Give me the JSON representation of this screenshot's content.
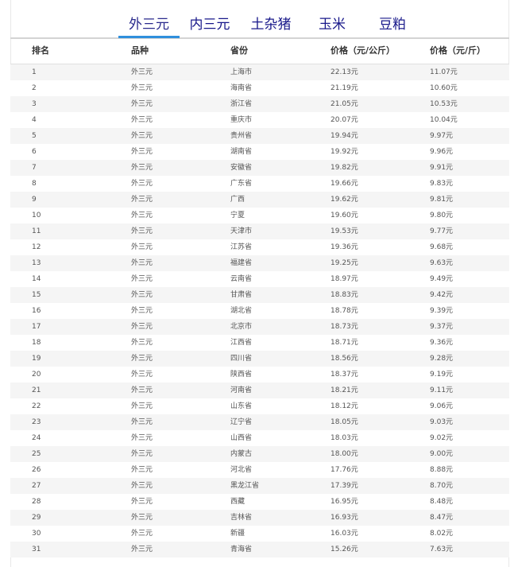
{
  "tabs": [
    {
      "label": "外三元",
      "active": true
    },
    {
      "label": "内三元",
      "active": false
    },
    {
      "label": "土杂猪",
      "active": false
    },
    {
      "label": "玉米",
      "active": false
    },
    {
      "label": "豆粕",
      "active": false
    }
  ],
  "table": {
    "headers": [
      "排名",
      "品种",
      "省份",
      "价格（元/公斤）",
      "价格（元/斤）"
    ],
    "rows": [
      [
        "1",
        "外三元",
        "上海市",
        "22.13元",
        "11.07元"
      ],
      [
        "2",
        "外三元",
        "海南省",
        "21.19元",
        "10.60元"
      ],
      [
        "3",
        "外三元",
        "浙江省",
        "21.05元",
        "10.53元"
      ],
      [
        "4",
        "外三元",
        "重庆市",
        "20.07元",
        "10.04元"
      ],
      [
        "5",
        "外三元",
        "贵州省",
        "19.94元",
        "9.97元"
      ],
      [
        "6",
        "外三元",
        "湖南省",
        "19.92元",
        "9.96元"
      ],
      [
        "7",
        "外三元",
        "安徽省",
        "19.82元",
        "9.91元"
      ],
      [
        "8",
        "外三元",
        "广东省",
        "19.66元",
        "9.83元"
      ],
      [
        "9",
        "外三元",
        "广西",
        "19.62元",
        "9.81元"
      ],
      [
        "10",
        "外三元",
        "宁夏",
        "19.60元",
        "9.80元"
      ],
      [
        "11",
        "外三元",
        "天津市",
        "19.53元",
        "9.77元"
      ],
      [
        "12",
        "外三元",
        "江苏省",
        "19.36元",
        "9.68元"
      ],
      [
        "13",
        "外三元",
        "福建省",
        "19.25元",
        "9.63元"
      ],
      [
        "14",
        "外三元",
        "云南省",
        "18.97元",
        "9.49元"
      ],
      [
        "15",
        "外三元",
        "甘肃省",
        "18.83元",
        "9.42元"
      ],
      [
        "16",
        "外三元",
        "湖北省",
        "18.78元",
        "9.39元"
      ],
      [
        "17",
        "外三元",
        "北京市",
        "18.73元",
        "9.37元"
      ],
      [
        "18",
        "外三元",
        "江西省",
        "18.71元",
        "9.36元"
      ],
      [
        "19",
        "外三元",
        "四川省",
        "18.56元",
        "9.28元"
      ],
      [
        "20",
        "外三元",
        "陕西省",
        "18.37元",
        "9.19元"
      ],
      [
        "21",
        "外三元",
        "河南省",
        "18.21元",
        "9.11元"
      ],
      [
        "22",
        "外三元",
        "山东省",
        "18.12元",
        "9.06元"
      ],
      [
        "23",
        "外三元",
        "辽宁省",
        "18.05元",
        "9.03元"
      ],
      [
        "24",
        "外三元",
        "山西省",
        "18.03元",
        "9.02元"
      ],
      [
        "25",
        "外三元",
        "内蒙古",
        "18.00元",
        "9.00元"
      ],
      [
        "26",
        "外三元",
        "河北省",
        "17.76元",
        "8.88元"
      ],
      [
        "27",
        "外三元",
        "黑龙江省",
        "17.39元",
        "8.70元"
      ],
      [
        "28",
        "外三元",
        "西藏",
        "16.95元",
        "8.48元"
      ],
      [
        "29",
        "外三元",
        "吉林省",
        "16.93元",
        "8.47元"
      ],
      [
        "30",
        "外三元",
        "新疆",
        "16.03元",
        "8.02元"
      ],
      [
        "31",
        "外三元",
        "青海省",
        "15.26元",
        "7.63元"
      ]
    ]
  },
  "colors": {
    "tab_text": "#18188a",
    "tab_active_underline": "#2f8fdc",
    "row_stripe": "#f5f5f5",
    "header_text": "#333333",
    "cell_text": "#555555"
  }
}
